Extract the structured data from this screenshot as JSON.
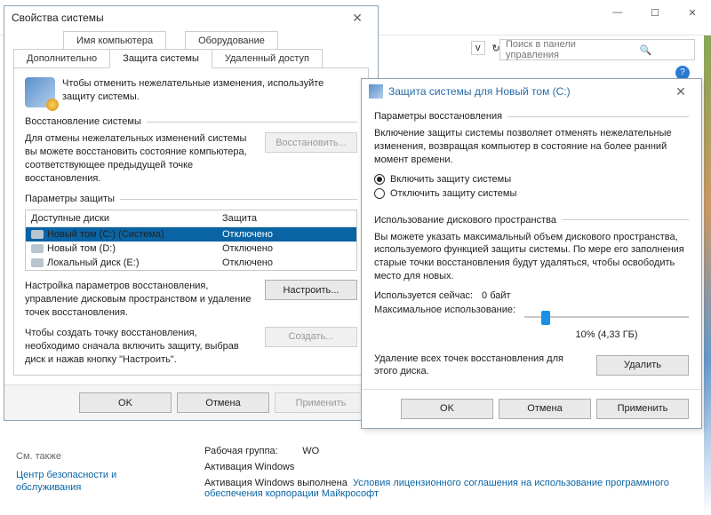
{
  "bgwin": {
    "nav_dropdown": "v",
    "refresh_icon": "↻",
    "search_placeholder": "Поиск в панели управления",
    "help_icon": "?"
  },
  "dlg1": {
    "title": "Свойства системы",
    "tabs": {
      "computer_name": "Имя компьютера",
      "hardware": "Оборудование",
      "advanced": "Дополнительно",
      "system_protection": "Защита системы",
      "remote": "Удаленный доступ"
    },
    "intro": "Чтобы отменить нежелательные изменения, используйте защиту системы.",
    "restore_group": "Восстановление системы",
    "restore_text": "Для отмены нежелательных изменений системы вы можете восстановить состояние компьютера, соответствующее предыдущей точке восстановления.",
    "restore_btn": "Восстановить...",
    "protection_group": "Параметры защиты",
    "table": {
      "col_drives": "Доступные диски",
      "col_protection": "Защита",
      "rows": [
        {
          "drive": "Новый том (C:) (Система)",
          "protection": "Отключено",
          "selected": true
        },
        {
          "drive": "Новый том (D:)",
          "protection": "Отключено",
          "selected": false
        },
        {
          "drive": "Локальный диск (E:)",
          "protection": "Отключено",
          "selected": false
        }
      ]
    },
    "configure_text": "Настройка параметров восстановления, управление дисковым пространством и удаление точек восстановления.",
    "configure_btn": "Настроить...",
    "create_text": "Чтобы создать точку восстановления, необходимо сначала включить защиту, выбрав диск и нажав кнопку \"Настроить\".",
    "create_btn": "Создать...",
    "ok": "OK",
    "cancel": "Отмена",
    "apply": "Применить"
  },
  "dlg2": {
    "title": "Защита системы для Новый том (C:)",
    "restore_group": "Параметры восстановления",
    "restore_intro": "Включение защиты системы позволяет отменять нежелательные изменения, возвращая компьютер в состояние на более ранний момент времени.",
    "radio_on": "Включить защиту системы",
    "radio_off": "Отключить защиту системы",
    "radio_selected": "on",
    "disk_group": "Использование дискового пространства",
    "disk_intro": "Вы можете указать максимальный объем дискового пространства, используемого функцией защиты системы. По мере его заполнения старые точки восстановления будут удаляться, чтобы освободить место для новых.",
    "used_label": "Используется сейчас:",
    "used_value": "0 байт",
    "max_label": "Максимальное использование:",
    "slider_percent": 10,
    "slider_text": "10% (4,33 ГБ)",
    "delete_text": "Удаление всех точек восстановления для этого диска.",
    "delete_btn": "Удалить",
    "ok": "OK",
    "cancel": "Отмена",
    "apply": "Применить"
  },
  "background": {
    "workgroup_label": "Рабочая группа:",
    "workgroup_value": "WO",
    "activation_label": "Активация Windows",
    "activation_text": "Активация Windows выполнена",
    "license_link": "Условия лицензионного соглашения на использование программного обеспечения корпорации Майкрософт",
    "see_also": "См. также",
    "security_link": "Центр безопасности и обслуживания"
  }
}
